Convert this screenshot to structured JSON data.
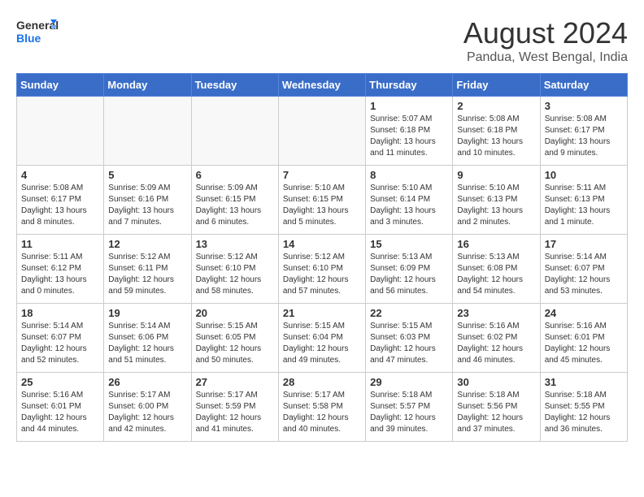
{
  "header": {
    "logo_line1": "General",
    "logo_line2": "Blue",
    "main_title": "August 2024",
    "subtitle": "Pandua, West Bengal, India"
  },
  "days_of_week": [
    "Sunday",
    "Monday",
    "Tuesday",
    "Wednesday",
    "Thursday",
    "Friday",
    "Saturday"
  ],
  "weeks": [
    [
      {
        "day": "",
        "detail": ""
      },
      {
        "day": "",
        "detail": ""
      },
      {
        "day": "",
        "detail": ""
      },
      {
        "day": "",
        "detail": ""
      },
      {
        "day": "1",
        "detail": "Sunrise: 5:07 AM\nSunset: 6:18 PM\nDaylight: 13 hours\nand 11 minutes."
      },
      {
        "day": "2",
        "detail": "Sunrise: 5:08 AM\nSunset: 6:18 PM\nDaylight: 13 hours\nand 10 minutes."
      },
      {
        "day": "3",
        "detail": "Sunrise: 5:08 AM\nSunset: 6:17 PM\nDaylight: 13 hours\nand 9 minutes."
      }
    ],
    [
      {
        "day": "4",
        "detail": "Sunrise: 5:08 AM\nSunset: 6:17 PM\nDaylight: 13 hours\nand 8 minutes."
      },
      {
        "day": "5",
        "detail": "Sunrise: 5:09 AM\nSunset: 6:16 PM\nDaylight: 13 hours\nand 7 minutes."
      },
      {
        "day": "6",
        "detail": "Sunrise: 5:09 AM\nSunset: 6:15 PM\nDaylight: 13 hours\nand 6 minutes."
      },
      {
        "day": "7",
        "detail": "Sunrise: 5:10 AM\nSunset: 6:15 PM\nDaylight: 13 hours\nand 5 minutes."
      },
      {
        "day": "8",
        "detail": "Sunrise: 5:10 AM\nSunset: 6:14 PM\nDaylight: 13 hours\nand 3 minutes."
      },
      {
        "day": "9",
        "detail": "Sunrise: 5:10 AM\nSunset: 6:13 PM\nDaylight: 13 hours\nand 2 minutes."
      },
      {
        "day": "10",
        "detail": "Sunrise: 5:11 AM\nSunset: 6:13 PM\nDaylight: 13 hours\nand 1 minute."
      }
    ],
    [
      {
        "day": "11",
        "detail": "Sunrise: 5:11 AM\nSunset: 6:12 PM\nDaylight: 13 hours\nand 0 minutes."
      },
      {
        "day": "12",
        "detail": "Sunrise: 5:12 AM\nSunset: 6:11 PM\nDaylight: 12 hours\nand 59 minutes."
      },
      {
        "day": "13",
        "detail": "Sunrise: 5:12 AM\nSunset: 6:10 PM\nDaylight: 12 hours\nand 58 minutes."
      },
      {
        "day": "14",
        "detail": "Sunrise: 5:12 AM\nSunset: 6:10 PM\nDaylight: 12 hours\nand 57 minutes."
      },
      {
        "day": "15",
        "detail": "Sunrise: 5:13 AM\nSunset: 6:09 PM\nDaylight: 12 hours\nand 56 minutes."
      },
      {
        "day": "16",
        "detail": "Sunrise: 5:13 AM\nSunset: 6:08 PM\nDaylight: 12 hours\nand 54 minutes."
      },
      {
        "day": "17",
        "detail": "Sunrise: 5:14 AM\nSunset: 6:07 PM\nDaylight: 12 hours\nand 53 minutes."
      }
    ],
    [
      {
        "day": "18",
        "detail": "Sunrise: 5:14 AM\nSunset: 6:07 PM\nDaylight: 12 hours\nand 52 minutes."
      },
      {
        "day": "19",
        "detail": "Sunrise: 5:14 AM\nSunset: 6:06 PM\nDaylight: 12 hours\nand 51 minutes."
      },
      {
        "day": "20",
        "detail": "Sunrise: 5:15 AM\nSunset: 6:05 PM\nDaylight: 12 hours\nand 50 minutes."
      },
      {
        "day": "21",
        "detail": "Sunrise: 5:15 AM\nSunset: 6:04 PM\nDaylight: 12 hours\nand 49 minutes."
      },
      {
        "day": "22",
        "detail": "Sunrise: 5:15 AM\nSunset: 6:03 PM\nDaylight: 12 hours\nand 47 minutes."
      },
      {
        "day": "23",
        "detail": "Sunrise: 5:16 AM\nSunset: 6:02 PM\nDaylight: 12 hours\nand 46 minutes."
      },
      {
        "day": "24",
        "detail": "Sunrise: 5:16 AM\nSunset: 6:01 PM\nDaylight: 12 hours\nand 45 minutes."
      }
    ],
    [
      {
        "day": "25",
        "detail": "Sunrise: 5:16 AM\nSunset: 6:01 PM\nDaylight: 12 hours\nand 44 minutes."
      },
      {
        "day": "26",
        "detail": "Sunrise: 5:17 AM\nSunset: 6:00 PM\nDaylight: 12 hours\nand 42 minutes."
      },
      {
        "day": "27",
        "detail": "Sunrise: 5:17 AM\nSunset: 5:59 PM\nDaylight: 12 hours\nand 41 minutes."
      },
      {
        "day": "28",
        "detail": "Sunrise: 5:17 AM\nSunset: 5:58 PM\nDaylight: 12 hours\nand 40 minutes."
      },
      {
        "day": "29",
        "detail": "Sunrise: 5:18 AM\nSunset: 5:57 PM\nDaylight: 12 hours\nand 39 minutes."
      },
      {
        "day": "30",
        "detail": "Sunrise: 5:18 AM\nSunset: 5:56 PM\nDaylight: 12 hours\nand 37 minutes."
      },
      {
        "day": "31",
        "detail": "Sunrise: 5:18 AM\nSunset: 5:55 PM\nDaylight: 12 hours\nand 36 minutes."
      }
    ]
  ]
}
